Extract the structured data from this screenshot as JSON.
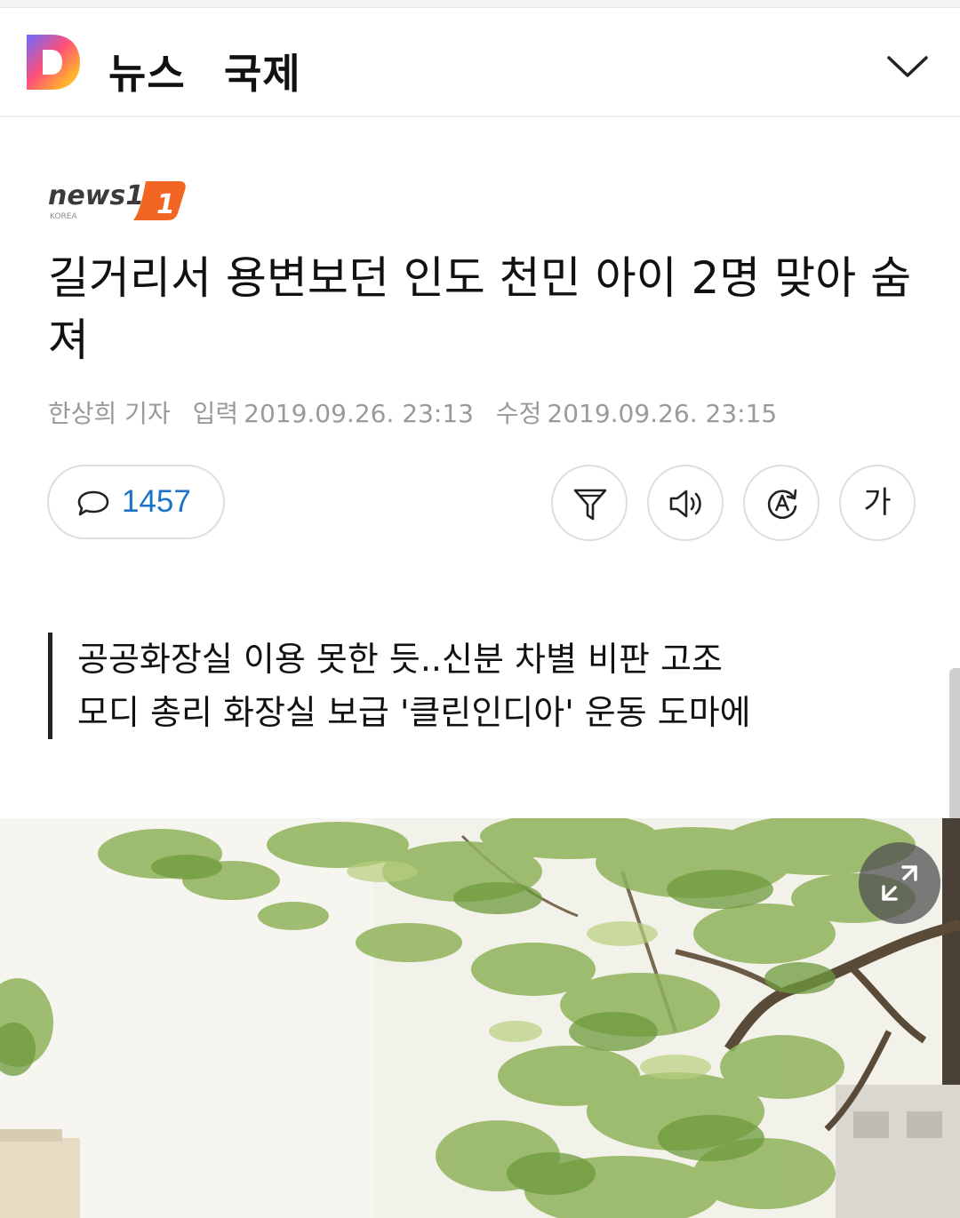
{
  "header": {
    "logo_letter": "D",
    "nav_news": "뉴스",
    "nav_section": "국제",
    "menu_icon": "chevron-down-icon"
  },
  "publisher": {
    "name": "news1",
    "sub": "KOREA",
    "accent": "#f26522"
  },
  "article": {
    "title": "길거리서 용변보던 인도 천민 아이 2명 맞아 숨져",
    "reporter": "한상희 기자",
    "input_label": "입력",
    "input_time": "2019.09.26. 23:13",
    "edit_label": "수정",
    "edit_time": "2019.09.26. 23:15",
    "summary": [
      "공공화장실 이용 못한 듯..신분 차별 비판 고조",
      "모디 총리 화장실 보급 '클린인디아' 운동 도마에"
    ]
  },
  "toolbar": {
    "comment_count": "1457",
    "comment_icon": "comment-bubble-icon",
    "summary_icon": "funnel-icon",
    "tts_icon": "speaker-icon",
    "translate_icon": "translate-icon",
    "font_label": "가"
  },
  "photo": {
    "expand_icon": "expand-icon"
  },
  "colors": {
    "comment_count": "#1a73c9",
    "meta_text": "#9a9a9a",
    "border": "#dedede"
  }
}
